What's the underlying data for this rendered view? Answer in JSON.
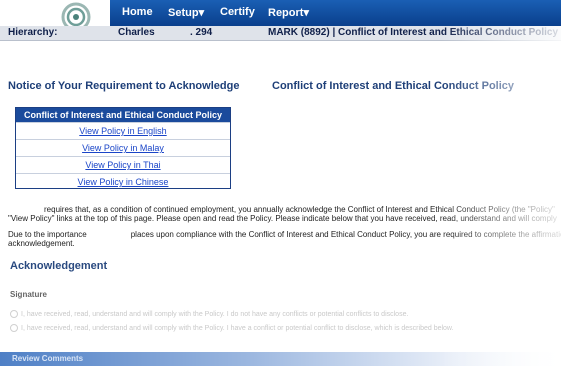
{
  "nav": {
    "items": [
      "Home",
      "Setup",
      "Certify",
      "Report"
    ],
    "dropdown_marker": "▾"
  },
  "hierarchy": {
    "label": "Hierarchy:",
    "name": "Charles",
    "code": ". 294",
    "path": "MARK (8892) | Conflict of Interest and Ethical Conduct Policy"
  },
  "notice": {
    "title": "Notice of Your Requirement to Acknowledge",
    "policy_title": "Conflict of Interest and Ethical Conduct Policy"
  },
  "policy_table": {
    "header": "Conflict of Interest and Ethical Conduct Policy",
    "links": [
      "View Policy in English",
      "View Policy in Malay",
      "View Policy in Thai",
      "View Policy in Chinese"
    ]
  },
  "paragraphs": {
    "p1_line1": "requires that, as a condition of continued employment, you annually acknowledge the Conflict of Interest and Ethical Conduct Policy (the \"Policy\"",
    "p1_line2": "\"View Policy\" links at the top of this page. Please open and read the Policy. Please indicate below that you have received, read, understand and will comply",
    "p2_line1_a": "Due to the importance",
    "p2_line1_b": "places upon compliance with the Conflict of Interest and Ethical Conduct Policy, you are required to complete the affirmation",
    "p2_line2": "acknowledgement."
  },
  "acknowledgement": {
    "title": "Acknowledgement",
    "signature_label": "Signature",
    "options": [
      "I,  have received, read, understand and will comply with the Policy. I do not have any conflicts or potential conflicts to disclose.",
      "I,  have received, read, understand and will comply with the Policy. I have a conflict or potential conflict to disclose, which is described below."
    ]
  },
  "review": {
    "title": "Review Comments"
  },
  "colors": {
    "nav_blue": "#1a5fb4",
    "table_header": "#1b4b9c",
    "link": "#1a45c8"
  }
}
